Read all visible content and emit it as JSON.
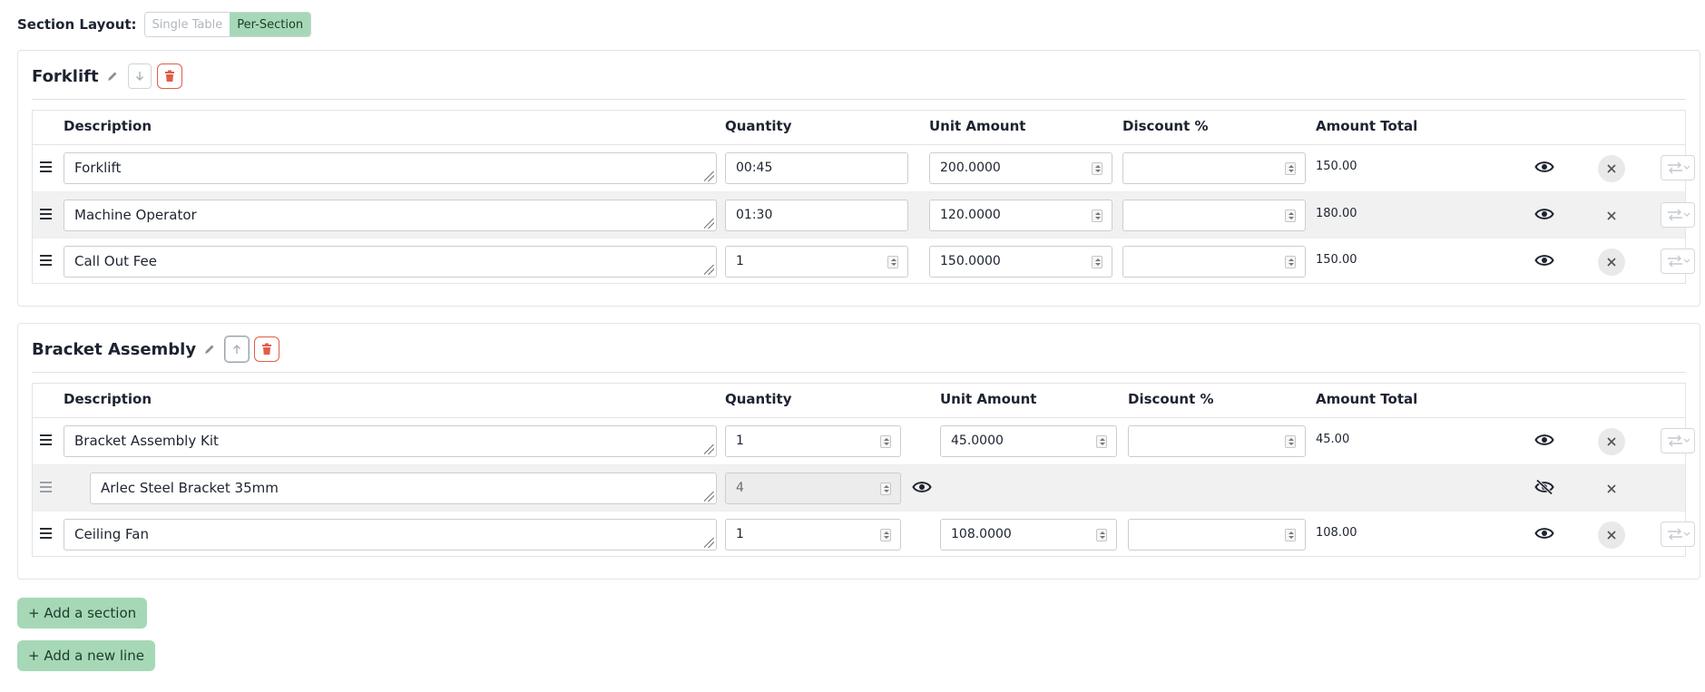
{
  "layout": {
    "label": "Section Layout:",
    "options": [
      "Single Table",
      "Per-Section"
    ],
    "selected": "Per-Section"
  },
  "columns": {
    "description": "Description",
    "quantity": "Quantity",
    "unit_amount": "Unit Amount",
    "discount": "Discount %",
    "amount_total": "Amount Total"
  },
  "sections": [
    {
      "title": "Forklift",
      "rows": [
        {
          "description": "Forklift",
          "quantity": "00:45",
          "unit_amount": "200.0000",
          "discount": "",
          "total": "150.00"
        },
        {
          "description": "Machine Operator",
          "quantity": "01:30",
          "unit_amount": "120.0000",
          "discount": "",
          "total": "180.00"
        },
        {
          "description": "Call Out Fee",
          "quantity": "1",
          "unit_amount": "150.0000",
          "discount": "",
          "total": "150.00"
        }
      ]
    },
    {
      "title": "Bracket Assembly",
      "rows": [
        {
          "description": "Bracket Assembly Kit",
          "quantity": "1",
          "unit_amount": "45.0000",
          "discount": "",
          "total": "45.00"
        },
        {
          "description": "Arlec Steel Bracket 35mm",
          "quantity": "4"
        },
        {
          "description": "Ceiling Fan",
          "quantity": "1",
          "unit_amount": "108.0000",
          "discount": "",
          "total": "108.00"
        }
      ]
    }
  ],
  "actions": {
    "add_section": "+ Add a section",
    "add_line": "+ Add a new line"
  },
  "icons": {
    "edit": "pencil-icon",
    "move_down": "arrow-down-icon",
    "move_up": "arrow-up-icon",
    "delete": "trash-icon",
    "drag": "drag-handle-icon",
    "visible": "eye-icon",
    "hidden": "eye-off-icon",
    "remove": "close-icon",
    "convert": "swap-icon"
  },
  "colors": {
    "accent_green": "#a6d8b7",
    "delete_red": "#e25c47"
  }
}
